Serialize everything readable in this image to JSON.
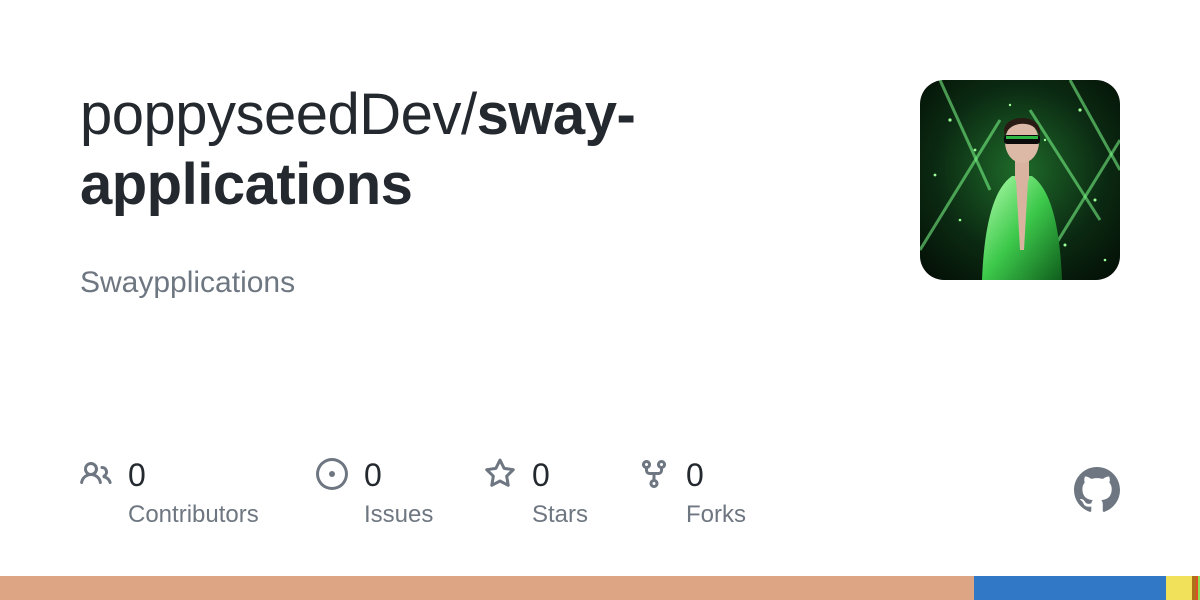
{
  "repo": {
    "owner": "poppyseedDev/",
    "name": "sway-applications",
    "description": "Swaypplications"
  },
  "avatar": {
    "alt": "owner avatar",
    "accent_color": "#39d353"
  },
  "stats": [
    {
      "key": "contributors",
      "icon": "people-icon",
      "count": "0",
      "label": "Contributors"
    },
    {
      "key": "issues",
      "icon": "issue-opened-icon",
      "count": "0",
      "label": "Issues"
    },
    {
      "key": "stars",
      "icon": "star-icon",
      "count": "0",
      "label": "Stars"
    },
    {
      "key": "forks",
      "icon": "repo-forked-icon",
      "count": "0",
      "label": "Forks"
    }
  ],
  "branding": {
    "logo": "github-mark-icon"
  },
  "language_bar": [
    {
      "color": "#dea584",
      "fraction": 0.8117
    },
    {
      "color": "#3178c6",
      "fraction": 0.16
    },
    {
      "color": "#f1e05a",
      "fraction": 0.0217
    },
    {
      "color": "#b07219",
      "fraction": 0.0033
    },
    {
      "color": "#e34c26",
      "fraction": 0.0017
    },
    {
      "color": "#89e051",
      "fraction": 0.0016
    }
  ]
}
